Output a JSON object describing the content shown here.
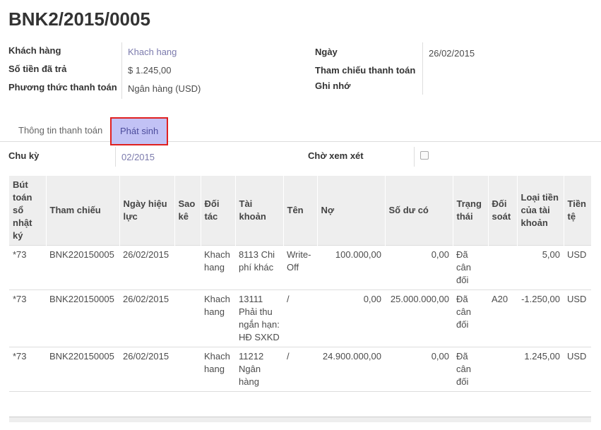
{
  "record": {
    "title": "BNK2/2015/0005"
  },
  "form": {
    "customer_label": "Khách hàng",
    "customer_value": "Khach hang",
    "amount_label": "Số tiền đã trả",
    "amount_value": "$ 1.245,00",
    "method_label": "Phương thức thanh toán",
    "method_value": "Ngân hàng (USD)",
    "date_label": "Ngày",
    "date_value": "26/02/2015",
    "ref_label": "Tham chiếu thanh toán",
    "memo_label": "Ghi nhớ"
  },
  "tabs": [
    {
      "label": "Thông tin thanh toán"
    },
    {
      "label": "Phát sinh"
    }
  ],
  "period": {
    "period_label": "Chu kỳ",
    "period_value": "02/2015",
    "review_label": "Chờ xem xét"
  },
  "table": {
    "headers": [
      "Bút toán sổ nhật ký",
      "Tham chiếu",
      "Ngày hiệu lực",
      "Sao kê",
      "Đối tác",
      "Tài khoản",
      "Tên",
      "Nợ",
      "Số dư có",
      "Trạng thái",
      "Đối soát",
      "Loại tiền của tài khoản",
      "Tiền tệ"
    ],
    "rows": [
      [
        "*73",
        "BNK220150005",
        "26/02/2015",
        "",
        "Khach hang",
        "8113 Chi phí khác",
        "Write-Off",
        "100.000,00",
        "0,00",
        "Đã cân đối",
        "",
        "5,00",
        "USD"
      ],
      [
        "*73",
        "BNK220150005",
        "26/02/2015",
        "",
        "Khach hang",
        "13111 Phải thu ngắn hạn: HĐ SXKD",
        "/",
        "0,00",
        "25.000.000,00",
        "Đã cân đối",
        "A20",
        "-1.250,00",
        "USD"
      ],
      [
        "*73",
        "BNK220150005",
        "26/02/2015",
        "",
        "Khach hang",
        "11212 Ngân hàng",
        "/",
        "24.900.000,00",
        "0,00",
        "Đã cân đối",
        "",
        "1.245,00",
        "USD"
      ]
    ]
  }
}
